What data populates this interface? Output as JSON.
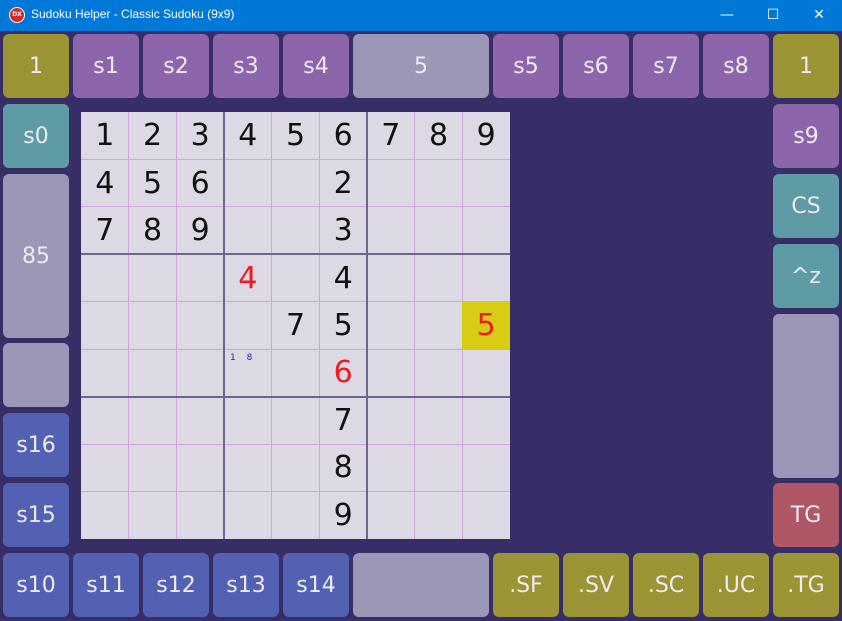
{
  "window": {
    "title": "Sudoku Helper - Classic Sudoku (9x9)",
    "icon_label": "DX",
    "minimize_glyph": "—",
    "maximize_glyph": "☐",
    "close_glyph": "✕"
  },
  "top_row": [
    "1",
    "s1",
    "s2",
    "s3",
    "s4",
    "5",
    "s5",
    "s6",
    "s7",
    "s8",
    "1"
  ],
  "left_col": [
    "s0",
    "85",
    "",
    "s16",
    "s15"
  ],
  "right_col": [
    "s9",
    "CS",
    "^z",
    "",
    "TG"
  ],
  "bottom_row": [
    "s10",
    "s11",
    "s12",
    "s13",
    "s14",
    "",
    ".SF",
    ".SV",
    ".SC",
    ".UC",
    ".TG"
  ],
  "colors": {
    "background": "#372e68",
    "titlebar": "#0078d7",
    "olive": "#9a9434",
    "purple": "#8d65aa",
    "grey": "#9c97b6",
    "teal": "#5e9ba4",
    "blue": "#5361b3",
    "red": "#b05766",
    "board": "#dcd9e4",
    "highlight": "#d8cc14",
    "red_digit": "#ee1c1c"
  },
  "grid": [
    [
      "1",
      "2",
      "3",
      "4",
      "5",
      "6",
      "7",
      "8",
      "9"
    ],
    [
      "4",
      "5",
      "6",
      "",
      "",
      "2",
      "",
      "",
      ""
    ],
    [
      "7",
      "8",
      "9",
      "",
      "",
      "3",
      "",
      "",
      ""
    ],
    [
      "",
      "",
      "",
      "4",
      "",
      "4",
      "",
      "",
      ""
    ],
    [
      "",
      "",
      "",
      "",
      "7",
      "5",
      "",
      "",
      "5"
    ],
    [
      "",
      "",
      "",
      "",
      "",
      "6",
      "",
      "",
      ""
    ],
    [
      "",
      "",
      "",
      "",
      "",
      "7",
      "",
      "",
      ""
    ],
    [
      "",
      "",
      "",
      "",
      "",
      "8",
      "",
      "",
      ""
    ],
    [
      "",
      "",
      "",
      "",
      "",
      "9",
      "",
      "",
      ""
    ]
  ],
  "red_cells": [
    "3-3",
    "4-8",
    "5-5"
  ],
  "highlight_cells": [
    "4-8"
  ],
  "notes": {
    "5-3": "1 8"
  }
}
